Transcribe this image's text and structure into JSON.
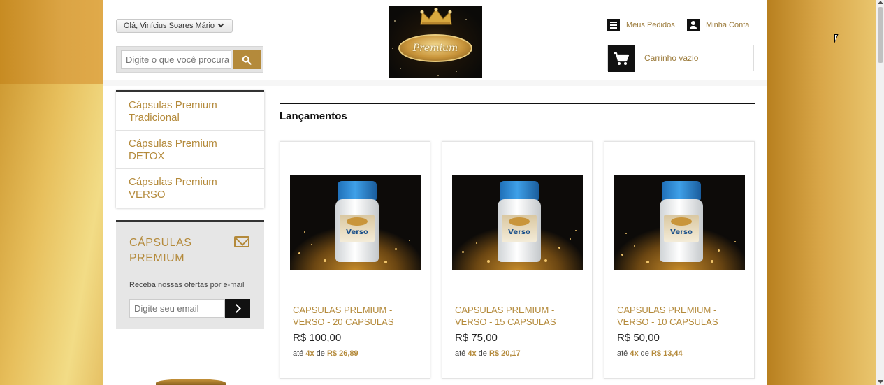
{
  "header": {
    "greeting": "Olá, Vinícius Soares Mário",
    "search_placeholder": "Digite o que você procura",
    "logo_text": "Premium",
    "orders_label": "Meus Pedidos",
    "account_label": "Minha Conta",
    "cart_label": "Carrinho vazio"
  },
  "sidebar": {
    "categories": [
      {
        "label": "Cápsulas Premium Tradicional"
      },
      {
        "label": "Cápsulas Premium DETOX"
      },
      {
        "label": "Cápsulas Premium VERSO"
      }
    ],
    "newsletter": {
      "title": "CÁPSULAS PREMIUM",
      "description": "Receba nossas ofertas por e-mail",
      "email_placeholder": "Digite seu email"
    }
  },
  "main": {
    "section_title": "Lançamentos",
    "products": [
      {
        "name": "CAPSULAS PREMIUM - VERSO - 20 CAPSULAS",
        "price": "R$ 100,00",
        "inst_prefix": "até",
        "inst_count": "4x",
        "inst_mid": "de",
        "inst_value": "R$ 26,89",
        "bottle_label": "Verso"
      },
      {
        "name": "CAPSULAS PREMIUM - VERSO - 15 CAPSULAS",
        "price": "R$ 75,00",
        "inst_prefix": "até",
        "inst_count": "4x",
        "inst_mid": "de",
        "inst_value": "R$ 20,17",
        "bottle_label": "Verso"
      },
      {
        "name": "CAPSULAS PREMIUM - VERSO - 10 CAPSULAS",
        "price": "R$ 50,00",
        "inst_prefix": "até",
        "inst_count": "4x",
        "inst_mid": "de",
        "inst_value": "R$ 13,44",
        "bottle_label": "Verso"
      }
    ]
  },
  "colors": {
    "accent_gold": "#b48a3b",
    "dark": "#111111",
    "background_gold": "#c48a26"
  },
  "icons": [
    "search-icon",
    "list-icon",
    "user-icon",
    "cart-icon",
    "envelope-icon",
    "chevron-right-icon",
    "chevron-down-icon"
  ]
}
